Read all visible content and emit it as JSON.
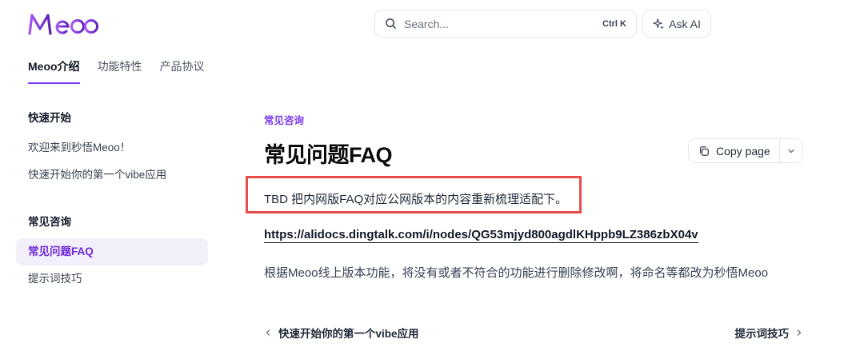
{
  "brand": {
    "logo_text": "Meoo",
    "accent": "#7c3aed"
  },
  "search": {
    "placeholder": "Search...",
    "shortcut": "Ctrl K"
  },
  "ask_ai": {
    "label": "Ask AI"
  },
  "tabs": [
    {
      "label": "Meoo介绍",
      "active": true
    },
    {
      "label": "功能特性",
      "active": false
    },
    {
      "label": "产品协议",
      "active": false
    }
  ],
  "sidebar": {
    "sections": [
      {
        "title": "快速开始",
        "items": [
          {
            "label": "欢迎来到秒悟Meoo！"
          },
          {
            "label": "快速开始你的第一个vibe应用"
          }
        ]
      },
      {
        "title": "常见咨询",
        "items": [
          {
            "label": "常见问题FAQ",
            "active": true
          },
          {
            "label": "提示词技巧"
          }
        ]
      }
    ]
  },
  "page": {
    "eyebrow": "常见咨询",
    "title": "常见问题FAQ",
    "copy_label": "Copy page",
    "note": "TBD 把内网版FAQ对应公网版本的内容重新梳理适配下。",
    "link": "https://alidocs.dingtalk.com/i/nodes/QG53mjyd800agdlKHppb9LZ386zbX04v",
    "paragraph": "根据Meoo线上版本功能，将没有或者不符合的功能进行删除修改啊，将命名等都改为秒悟Meoo",
    "prev_label": "快速开始你的第一个vibe应用",
    "next_label": "提示词技巧"
  },
  "colors": {
    "highlight_border": "#e74c4c",
    "active_item_bg": "#f3effb"
  },
  "icons": [
    "search-icon",
    "sparkle-icon",
    "copy-icon",
    "chevron-down-icon",
    "chevron-left-icon",
    "chevron-right-icon"
  ]
}
